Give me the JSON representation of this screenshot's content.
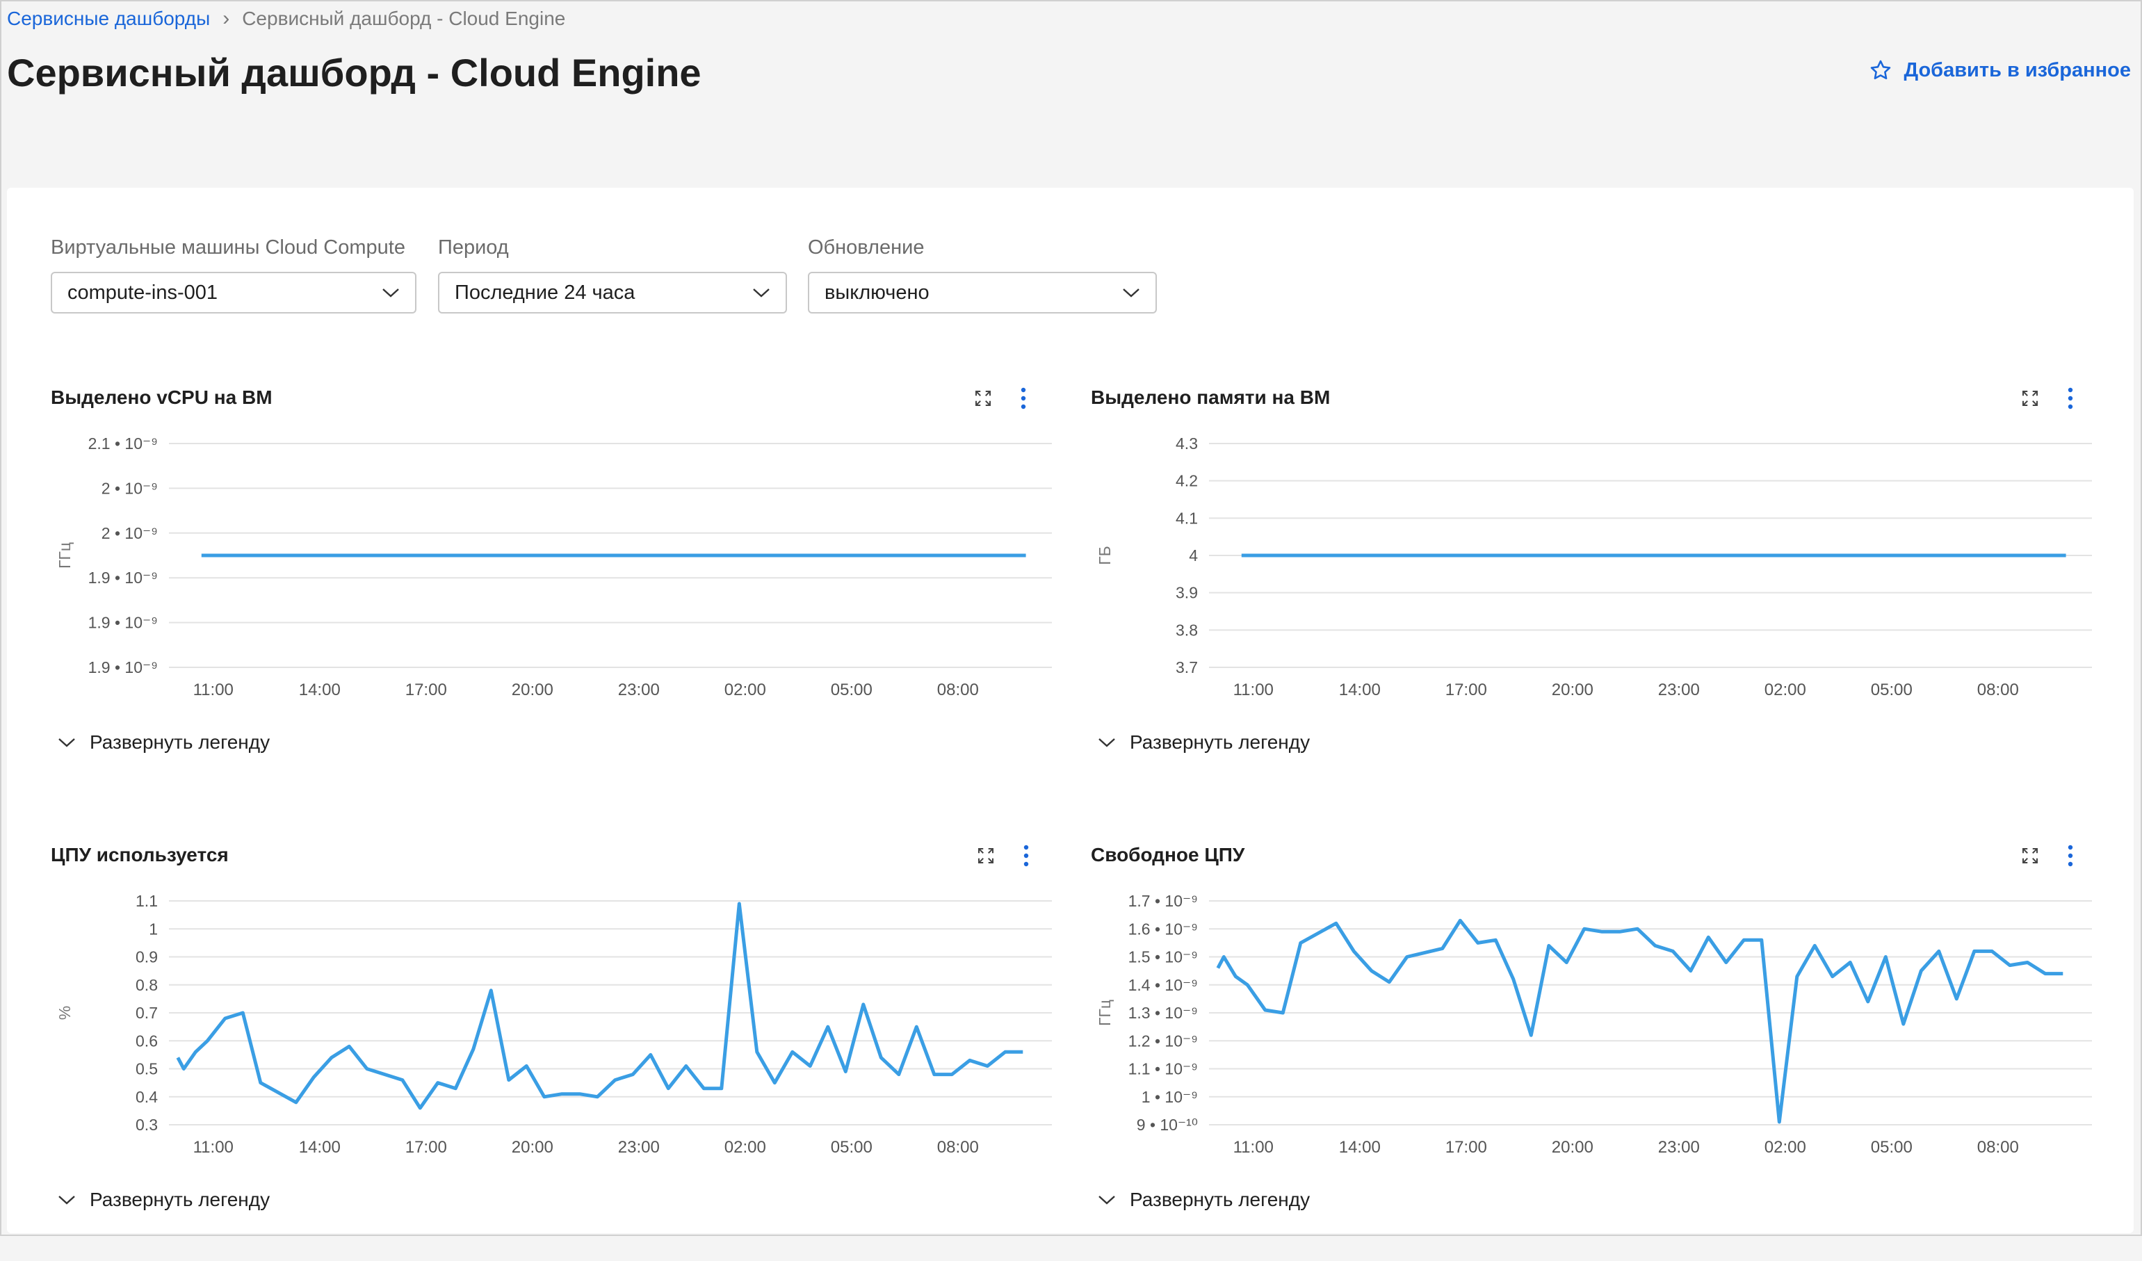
{
  "breadcrumb": {
    "parent": "Сервисные дашборды",
    "current": "Сервисный дашборд - Cloud Engine"
  },
  "page": {
    "title": "Сервисный дашборд - Cloud Engine",
    "favorite_label": "Добавить в избранное"
  },
  "filters": [
    {
      "label": "Виртуальные машины Cloud Compute",
      "value": "compute-ins-001"
    },
    {
      "label": "Период",
      "value": "Последние 24 часа"
    },
    {
      "label": "Обновление",
      "value": "выключено"
    }
  ],
  "legend_toggle_label": "Развернуть легенду",
  "colors": {
    "accent": "#1a66d9",
    "series": "#3a9ee4",
    "grid": "#e3e3e3"
  },
  "icons": {
    "favorite": "star-icon",
    "expand": "expand-icon",
    "menu": "more-vertical-icon",
    "chevron": "chevron-down-icon"
  },
  "chart_data": [
    {
      "type": "line",
      "title": "Выделено vCPU на ВМ",
      "ylabel": "ГГц",
      "x_ticks": [
        "11:00",
        "14:00",
        "17:00",
        "20:00",
        "23:00",
        "02:00",
        "05:00",
        "08:00"
      ],
      "y_ticks": [
        "2.1 • 10⁻⁹",
        "2 • 10⁻⁹",
        "2 • 10⁻⁹",
        "1.9 • 10⁻⁹",
        "1.9 • 10⁻⁹",
        "1.9 • 10⁻⁹"
      ],
      "ylim": [
        1.9e-09,
        2.1e-09
      ],
      "grid": true,
      "x": [
        "10:40",
        "09:55"
      ],
      "values": [
        2e-09,
        2e-09
      ]
    },
    {
      "type": "line",
      "title": "Выделено памяти на ВМ",
      "ylabel": "ГБ",
      "x_ticks": [
        "11:00",
        "14:00",
        "17:00",
        "20:00",
        "23:00",
        "02:00",
        "05:00",
        "08:00"
      ],
      "y_ticks": [
        "4.3",
        "4.2",
        "4.1",
        "4",
        "3.9",
        "3.8",
        "3.7"
      ],
      "ylim": [
        3.7,
        4.3
      ],
      "grid": true,
      "x": [
        "10:40",
        "09:55"
      ],
      "values": [
        4.0,
        4.0
      ]
    },
    {
      "type": "line",
      "title": "ЦПУ используется",
      "ylabel": "%",
      "x_ticks": [
        "11:00",
        "14:00",
        "17:00",
        "20:00",
        "23:00",
        "02:00",
        "05:00",
        "08:00"
      ],
      "y_ticks": [
        "1.1",
        "1",
        "0.9",
        "0.8",
        "0.7",
        "0.6",
        "0.5",
        "0.4",
        "0.3"
      ],
      "ylim": [
        0.3,
        1.1
      ],
      "grid": true,
      "x": [
        "10:00",
        "10:10",
        "10:30",
        "10:50",
        "11:20",
        "11:50",
        "12:20",
        "13:20",
        "13:50",
        "14:20",
        "14:50",
        "15:20",
        "16:20",
        "16:50",
        "17:20",
        "17:50",
        "18:20",
        "18:50",
        "19:20",
        "19:50",
        "20:20",
        "20:50",
        "21:20",
        "21:50",
        "22:20",
        "22:50",
        "23:20",
        "23:50",
        "00:20",
        "00:50",
        "01:20",
        "01:50",
        "02:20",
        "02:50",
        "03:20",
        "03:50",
        "04:20",
        "04:50",
        "05:20",
        "05:50",
        "06:20",
        "06:50",
        "07:20",
        "07:50",
        "08:20",
        "08:50",
        "09:20",
        "09:50"
      ],
      "values": [
        0.54,
        0.5,
        0.56,
        0.6,
        0.68,
        0.7,
        0.45,
        0.38,
        0.47,
        0.54,
        0.58,
        0.5,
        0.46,
        0.36,
        0.45,
        0.43,
        0.57,
        0.78,
        0.46,
        0.51,
        0.4,
        0.41,
        0.41,
        0.4,
        0.46,
        0.48,
        0.55,
        0.43,
        0.51,
        0.43,
        0.43,
        1.09,
        0.56,
        0.45,
        0.56,
        0.51,
        0.65,
        0.49,
        0.73,
        0.54,
        0.48,
        0.65,
        0.48,
        0.48,
        0.53,
        0.51,
        0.56,
        0.56
      ]
    },
    {
      "type": "line",
      "title": "Свободное ЦПУ",
      "ylabel": "ГГц",
      "x_ticks": [
        "11:00",
        "14:00",
        "17:00",
        "20:00",
        "23:00",
        "02:00",
        "05:00",
        "08:00"
      ],
      "y_ticks": [
        "1.7 • 10⁻⁹",
        "1.6 • 10⁻⁹",
        "1.5 • 10⁻⁹",
        "1.4 • 10⁻⁹",
        "1.3 • 10⁻⁹",
        "1.2 • 10⁻⁹",
        "1.1 • 10⁻⁹",
        "1 • 10⁻⁹",
        "9 • 10⁻¹⁰"
      ],
      "ylim": [
        9e-10,
        1.7e-09
      ],
      "grid": true,
      "x": [
        "10:00",
        "10:10",
        "10:30",
        "10:50",
        "11:20",
        "11:50",
        "12:20",
        "13:20",
        "13:50",
        "14:20",
        "14:50",
        "15:20",
        "16:20",
        "16:50",
        "17:20",
        "17:50",
        "18:20",
        "18:50",
        "19:20",
        "19:50",
        "20:20",
        "20:50",
        "21:20",
        "21:50",
        "22:20",
        "22:50",
        "23:20",
        "23:50",
        "00:20",
        "00:50",
        "01:20",
        "01:50",
        "02:20",
        "02:50",
        "03:20",
        "03:50",
        "04:20",
        "04:50",
        "05:20",
        "05:50",
        "06:20",
        "06:50",
        "07:20",
        "07:50",
        "08:20",
        "08:50",
        "09:20",
        "09:50"
      ],
      "values": [
        1.46e-09,
        1.5e-09,
        1.43e-09,
        1.4e-09,
        1.31e-09,
        1.3e-09,
        1.55e-09,
        1.62e-09,
        1.52e-09,
        1.45e-09,
        1.41e-09,
        1.5e-09,
        1.53e-09,
        1.63e-09,
        1.55e-09,
        1.56e-09,
        1.42e-09,
        1.22e-09,
        1.54e-09,
        1.48e-09,
        1.6e-09,
        1.59e-09,
        1.59e-09,
        1.6e-09,
        1.54e-09,
        1.52e-09,
        1.45e-09,
        1.57e-09,
        1.48e-09,
        1.56e-09,
        1.56e-09,
        9.1e-10,
        1.43e-09,
        1.54e-09,
        1.43e-09,
        1.48e-09,
        1.34e-09,
        1.5e-09,
        1.26e-09,
        1.45e-09,
        1.52e-09,
        1.35e-09,
        1.52e-09,
        1.52e-09,
        1.47e-09,
        1.48e-09,
        1.44e-09,
        1.44e-09
      ]
    }
  ]
}
